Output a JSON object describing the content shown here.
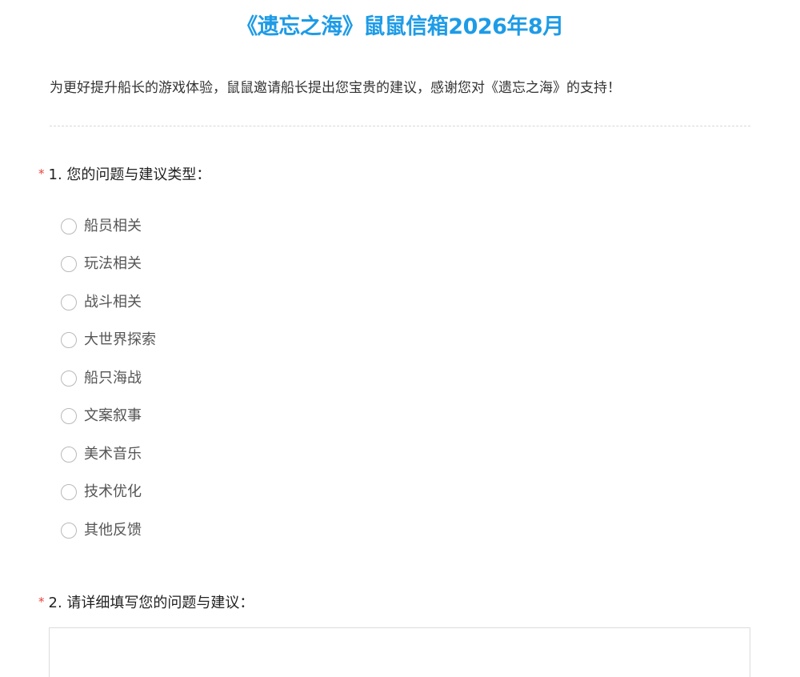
{
  "title": "《遗忘之海》鼠鼠信箱2026年8月",
  "intro": "为更好提升船长的游戏体验，鼠鼠邀请船长提出您宝贵的建议，感谢您对《遗忘之海》的支持！",
  "required_mark": "*",
  "question1": {
    "label": "1. 您的问题与建议类型：",
    "options": [
      "船员相关",
      "玩法相关",
      "战斗相关",
      "大世界探索",
      "船只海战",
      "文案叙事",
      "美术音乐",
      "技术优化",
      "其他反馈"
    ]
  },
  "question2": {
    "label": "2. 请详细填写您的问题与建议：",
    "value": "",
    "placeholder": ""
  },
  "colors": {
    "title": "#1e9be6",
    "required": "#e8413a"
  }
}
